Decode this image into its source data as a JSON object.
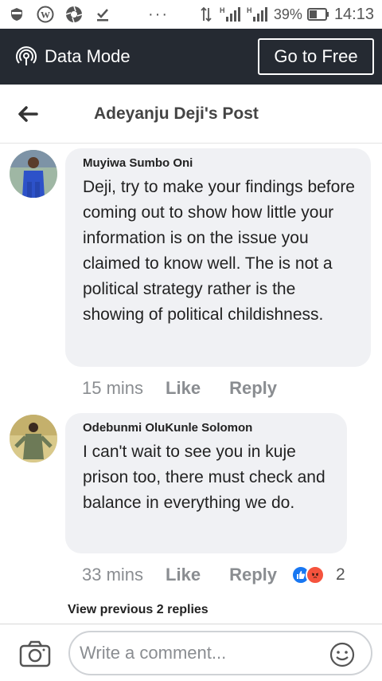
{
  "status_bar": {
    "battery_percent": "39%",
    "time": "14:13",
    "dots": "···",
    "signal_label": "H"
  },
  "data_mode": {
    "label": "Data Mode",
    "button": "Go to Free"
  },
  "header": {
    "title": "Adeyanju Deji's Post"
  },
  "comments": [
    {
      "name": "Muyiwa Sumbo Oni",
      "text": "Deji, try to make your findings before coming out to show how little your information is on the issue you claimed to know well. The is not a political strategy rather is the showing of political childishness.",
      "time": "15 mins",
      "like": "Like",
      "reply": "Reply"
    },
    {
      "name": "Odebunmi OluKunle Solomon",
      "text": "I can't wait to see you in kuje prison too,  there must check and balance in everything we do.",
      "time": "33 mins",
      "like": "Like",
      "reply": "Reply",
      "reaction_count": "2"
    }
  ],
  "view_previous": "View previous 2 replies",
  "composer": {
    "placeholder": "Write a comment..."
  },
  "colors": {
    "data_bar": "#252a32",
    "bubble": "#f0f1f4",
    "like_blue": "#1877f2",
    "angry_red": "#f5533d"
  }
}
